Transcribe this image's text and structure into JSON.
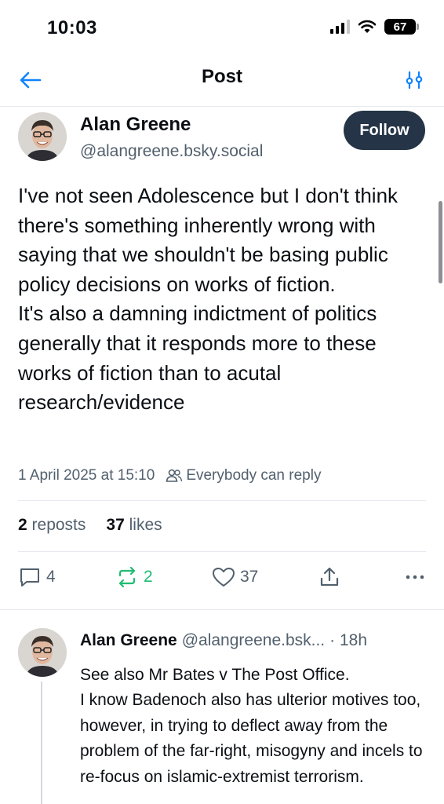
{
  "status_bar": {
    "time": "10:03",
    "battery": "67"
  },
  "nav": {
    "title": "Post"
  },
  "post": {
    "author_name": "Alan Greene",
    "author_handle": "@alangreene.bsky.social",
    "follow_label": "Follow",
    "text": "I've not seen Adolescence but I don't think there's something inherently wrong with saying that we shouldn't be basing public policy decisions on works of fiction.\nIt's also a damning indictment of politics generally that it responds more to these works of fiction than to acutal research/evidence",
    "date": "1 April 2025 at 15:10",
    "reply_setting": "Everybody can reply",
    "reposts_count": "2",
    "reposts_label": "reposts",
    "likes_count": "37",
    "likes_label": "likes",
    "actions": {
      "replies": "4",
      "reposts": "2",
      "likes": "37"
    }
  },
  "reply": {
    "author_name": "Alan Greene",
    "author_handle": "@alangreene.bsk...",
    "time": "· 18h",
    "text": "See also Mr Bates v The Post Office.\nI know Badenoch also has ulterior motives too, however, in trying to deflect away from the problem of the far-right, misogyny and incels to re-focus on islamic-extremist terrorism."
  },
  "colors": {
    "follow_bg": "#253446",
    "repost_active": "#20bc73",
    "accent": "#1083fe",
    "muted": "#52606d"
  }
}
